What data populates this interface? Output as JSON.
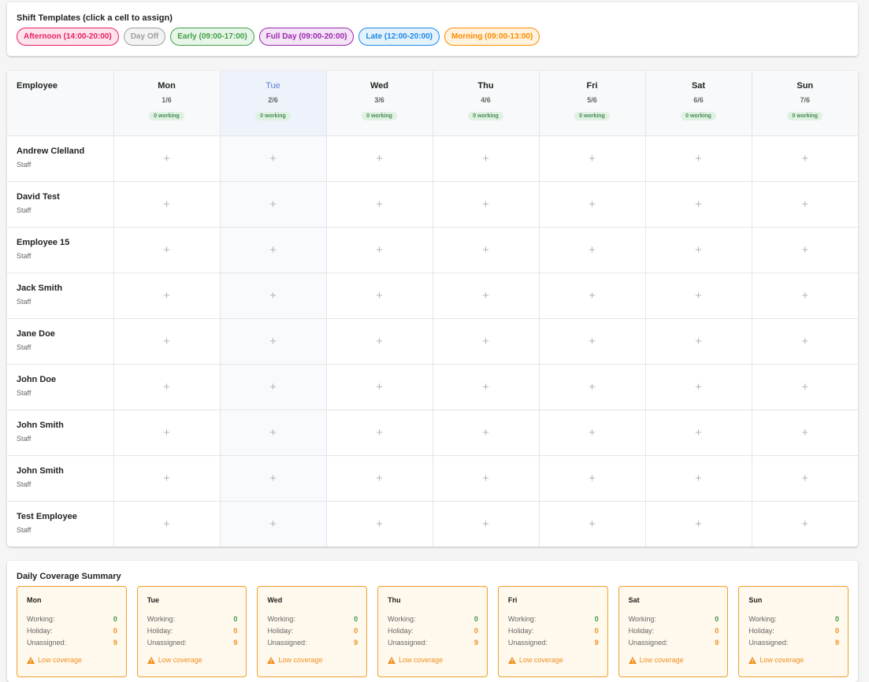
{
  "templates": {
    "title": "Shift Templates (click a cell to assign)",
    "chips": [
      {
        "label": "Afternoon (14:00-20:00)",
        "color": "#e91e63",
        "bg": "#fde4ec",
        "border": "#e91e63"
      },
      {
        "label": "Day Off",
        "color": "#9e9e9e",
        "bg": "#f3f3f3",
        "border": "#9e9e9e"
      },
      {
        "label": "Early (09:00-17:00)",
        "color": "#43a047",
        "bg": "#e8f5e9",
        "border": "#43a047"
      },
      {
        "label": "Full Day (09:00-20:00)",
        "color": "#9c27b0",
        "bg": "#f3e5f5",
        "border": "#9c27b0"
      },
      {
        "label": "Late (12:00-20:00)",
        "color": "#1e88e5",
        "bg": "#e3f2fd",
        "border": "#1e88e5"
      },
      {
        "label": "Morning (09:00-13:00)",
        "color": "#fb8c00",
        "bg": "#fff3e0",
        "border": "#fb8c00"
      }
    ]
  },
  "grid": {
    "employee_header": "Employee",
    "days": [
      {
        "name": "Mon",
        "date": "1/6",
        "working": "0 working",
        "today": false
      },
      {
        "name": "Tue",
        "date": "2/6",
        "working": "0 working",
        "today": true
      },
      {
        "name": "Wed",
        "date": "3/6",
        "working": "0 working",
        "today": false
      },
      {
        "name": "Thu",
        "date": "4/6",
        "working": "0 working",
        "today": false
      },
      {
        "name": "Fri",
        "date": "5/6",
        "working": "0 working",
        "today": false
      },
      {
        "name": "Sat",
        "date": "6/6",
        "working": "0 working",
        "today": false
      },
      {
        "name": "Sun",
        "date": "7/6",
        "working": "0 working",
        "today": false
      }
    ],
    "slot_symbol": "+",
    "employees": [
      {
        "name": "Andrew Clelland",
        "role": "Staff"
      },
      {
        "name": "David Test",
        "role": "Staff"
      },
      {
        "name": "Employee 15",
        "role": "Staff"
      },
      {
        "name": "Jack Smith",
        "role": "Staff"
      },
      {
        "name": "Jane Doe",
        "role": "Staff"
      },
      {
        "name": "John Doe",
        "role": "Staff"
      },
      {
        "name": "John Smith",
        "role": "Staff"
      },
      {
        "name": "John Smith",
        "role": "Staff"
      },
      {
        "name": "Test Employee",
        "role": "Staff"
      }
    ]
  },
  "coverage": {
    "title": "Daily Coverage Summary",
    "working_label": "Working:",
    "holiday_label": "Holiday:",
    "unassigned_label": "Unassigned:",
    "low_label": "Low coverage",
    "days": [
      {
        "day": "Mon",
        "working": "0",
        "holiday": "0",
        "unassigned": "9"
      },
      {
        "day": "Tue",
        "working": "0",
        "holiday": "0",
        "unassigned": "9"
      },
      {
        "day": "Wed",
        "working": "0",
        "holiday": "0",
        "unassigned": "9"
      },
      {
        "day": "Thu",
        "working": "0",
        "holiday": "0",
        "unassigned": "9"
      },
      {
        "day": "Fri",
        "working": "0",
        "holiday": "0",
        "unassigned": "9"
      },
      {
        "day": "Sat",
        "working": "0",
        "holiday": "0",
        "unassigned": "9"
      },
      {
        "day": "Sun",
        "working": "0",
        "holiday": "0",
        "unassigned": "9"
      }
    ]
  }
}
